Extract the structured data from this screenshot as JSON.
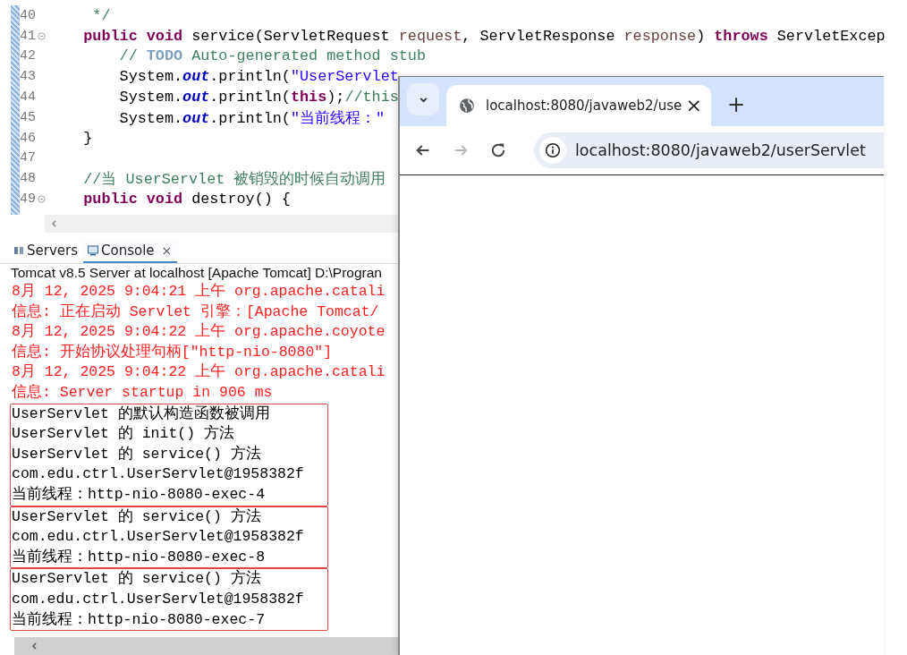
{
  "editor": {
    "lines": [
      {
        "number": "40",
        "fold": false,
        "tokens": [
          {
            "kind": "comment",
            "text": "     */"
          }
        ]
      },
      {
        "number": "41",
        "fold": true,
        "tokens": [
          {
            "kind": "keyword",
            "text": "    public void"
          },
          {
            "kind": "plain",
            "text": " service(ServletRequest "
          },
          {
            "kind": "param",
            "text": "request"
          },
          {
            "kind": "plain",
            "text": ", ServletResponse "
          },
          {
            "kind": "param",
            "text": "response"
          },
          {
            "kind": "plain",
            "text": ") "
          },
          {
            "kind": "keyword",
            "text": "throws"
          },
          {
            "kind": "plain",
            "text": " ServletExcep"
          }
        ]
      },
      {
        "number": "42",
        "fold": false,
        "tokens": [
          {
            "kind": "comment",
            "text": "        // "
          },
          {
            "kind": "todo",
            "text": "TODO"
          },
          {
            "kind": "comment",
            "text": " Auto-generated method stub"
          }
        ]
      },
      {
        "number": "43",
        "fold": false,
        "tokens": [
          {
            "kind": "plain",
            "text": "        System."
          },
          {
            "kind": "field",
            "text": "out"
          },
          {
            "kind": "plain",
            "text": ".println("
          },
          {
            "kind": "string",
            "text": "\"UserServlet"
          }
        ]
      },
      {
        "number": "44",
        "fold": false,
        "tokens": [
          {
            "kind": "plain",
            "text": "        System."
          },
          {
            "kind": "field",
            "text": "out"
          },
          {
            "kind": "plain",
            "text": ".println("
          },
          {
            "kind": "keyword",
            "text": "this"
          },
          {
            "kind": "plain",
            "text": ");"
          },
          {
            "kind": "comment",
            "text": "//this"
          }
        ]
      },
      {
        "number": "45",
        "fold": false,
        "tokens": [
          {
            "kind": "plain",
            "text": "        System."
          },
          {
            "kind": "field",
            "text": "out"
          },
          {
            "kind": "plain",
            "text": ".println("
          },
          {
            "kind": "string",
            "text": "\"当前线程：\""
          }
        ]
      },
      {
        "number": "46",
        "fold": false,
        "tokens": [
          {
            "kind": "plain",
            "text": "    }"
          }
        ]
      },
      {
        "number": "47",
        "fold": false
      },
      {
        "number": "48",
        "fold": false,
        "tokens": [
          {
            "kind": "comment",
            "text": "    //当 UserServlet 被销毁的时候自动调用"
          }
        ]
      },
      {
        "number": "49",
        "fold": true,
        "tokens": [
          {
            "kind": "keyword",
            "text": "    public void"
          },
          {
            "kind": "plain",
            "text": " destroy() {"
          }
        ]
      }
    ]
  },
  "views": {
    "tabs": [
      {
        "label": "Servers",
        "selected": false
      },
      {
        "label": "Console",
        "selected": true,
        "close": "×"
      }
    ],
    "description": "Tomcat v8.5 Server at localhost [Apache Tomcat] D:\\Progran",
    "log_lines": [
      "8月 12, 2025 9:04:21 上午 org.apache.catali",
      "信息: 正在启动 Servlet 引擎：[Apache Tomcat/",
      "8月 12, 2025 9:04:22 上午 org.apache.coyote",
      "信息: 开始协议处理句柄[\"http-nio-8080\"]",
      "8月 12, 2025 9:04:22 上午 org.apache.catali",
      "信息: Server startup in 906 ms"
    ],
    "highlighted_groups": [
      {
        "lines": [
          "UserServlet 的默认构造函数被调用",
          "UserServlet 的 init() 方法",
          "UserServlet 的 service() 方法",
          "com.edu.ctrl.UserServlet@1958382f",
          "当前线程：http-nio-8080-exec-4"
        ]
      },
      {
        "lines": [
          "UserServlet 的 service() 方法",
          "com.edu.ctrl.UserServlet@1958382f",
          "当前线程：http-nio-8080-exec-8"
        ]
      },
      {
        "lines": [
          "UserServlet 的 service() 方法",
          "com.edu.ctrl.UserServlet@1958382f",
          "当前线程：http-nio-8080-exec-7"
        ]
      }
    ]
  },
  "browser": {
    "tab": {
      "title": "localhost:8080/javaweb2/use",
      "close": "×"
    },
    "new_tab": "+",
    "forward_disabled": true,
    "address": "localhost:8080/javaweb2/userServlet"
  }
}
